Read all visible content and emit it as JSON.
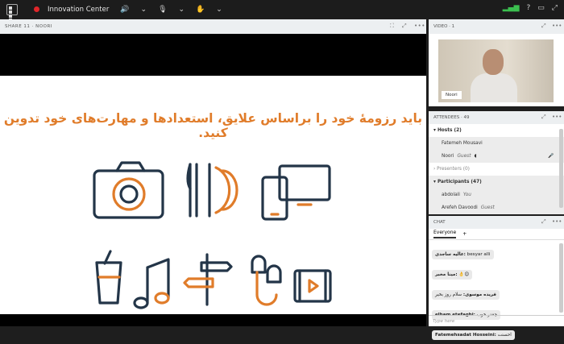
{
  "app": {
    "title": "Innovation Center"
  },
  "share": {
    "header": "SHARE 11  ·  NOORI",
    "headline": "باید رزومهٔ خود را براساس علایق، استعدادها و مهارت‌های خود تدوین کنید."
  },
  "video": {
    "header": "VIDEO · 1",
    "name_tag": "Noori"
  },
  "attendees": {
    "header": "ATTENDEES · 49",
    "hosts": "Hosts (2)",
    "host1": "Fatemeh Mousavi",
    "host2": "Noori",
    "host2_role": "Guest",
    "presenters": "Presenters (0)",
    "participants": "Participants (47)",
    "p1": "abdolali",
    "p1_role": "You",
    "p2": "Arefeh Davoodi",
    "p2_role": "Guest"
  },
  "chat": {
    "header": "CHAT",
    "tab": "Everyone",
    "messages": [
      {
        "name": "عالیه ساجدی:",
        "text": "besyar alli"
      },
      {
        "name": "مینا مخبر:",
        "text": "👌😊"
      },
      {
        "name": "فریده موسوی:",
        "text": "سلام روز بخیر"
      },
      {
        "name": "elham etefaghi:",
        "text": "چقدر خوب"
      },
      {
        "name": "Fatemehsadat Hosseini:",
        "text": "احسنت"
      }
    ],
    "placeholder": "Type here"
  },
  "colors": {
    "accent": "#e07c2a",
    "icon_dark": "#233548"
  }
}
